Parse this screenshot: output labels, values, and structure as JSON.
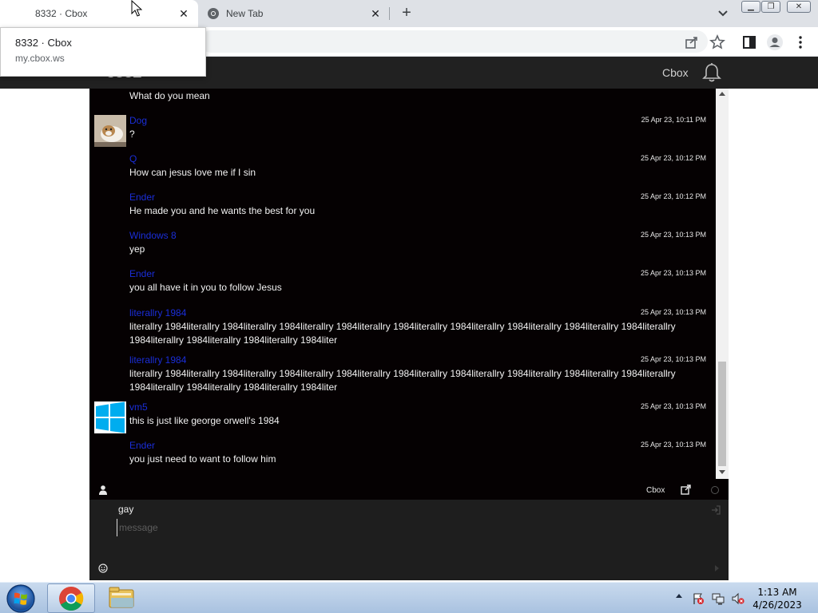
{
  "browser": {
    "tabs": [
      {
        "title": "8332 · Cbox",
        "active": true
      },
      {
        "title": "New Tab",
        "active": false
      }
    ],
    "tooltip": {
      "title": "8332 · Cbox",
      "url": "my.cbox.ws"
    }
  },
  "site": {
    "header_title": "8332",
    "header_link": "Cbox"
  },
  "chat": {
    "messages": [
      {
        "name": "",
        "time": "",
        "text": "What do you mean",
        "avatar": "none"
      },
      {
        "name": "Dog",
        "time": "25 Apr 23, 10:11 PM",
        "text": "?",
        "avatar": "dog-photo"
      },
      {
        "name": "Q",
        "time": "25 Apr 23, 10:12 PM",
        "text": "How can jesus love me if I sin",
        "avatar": "none"
      },
      {
        "name": "Ender",
        "time": "25 Apr 23, 10:12 PM",
        "text": "He made you and he wants the best for you",
        "avatar": "none"
      },
      {
        "name": "Windows 8",
        "time": "25 Apr 23, 10:13 PM",
        "text": "yep",
        "avatar": "none"
      },
      {
        "name": "Ender",
        "time": "25 Apr 23, 10:13 PM",
        "text": "you all have it in you to follow Jesus",
        "avatar": "none"
      },
      {
        "name": "literallry 1984",
        "time": "25 Apr 23, 10:13 PM",
        "text": "literallry 1984literallry 1984literallry 1984literallry 1984literallry 1984literallry 1984literallry 1984literallry 1984literallry 1984literallry 1984literallry 1984literallry 1984literallry 1984liter",
        "avatar": "none"
      },
      {
        "name": "literallry 1984",
        "time": "25 Apr 23, 10:13 PM",
        "text": "literallry 1984literallry 1984literallry 1984literallry 1984literallry 1984literallry 1984literallry 1984literallry 1984literallry 1984literallry 1984literallry 1984literallry 1984literallry 1984liter",
        "avatar": "none"
      },
      {
        "name": "vm5",
        "time": "25 Apr 23, 10:13 PM",
        "text": "this is just like george orwell's 1984",
        "avatar": "windows-logo"
      },
      {
        "name": "Ender",
        "time": "25 Apr 23, 10:13 PM",
        "text": "you just need to want to follow him",
        "avatar": "none"
      }
    ],
    "bar_label": "Cbox",
    "compose": {
      "username": "gay",
      "placeholder": "message"
    }
  },
  "taskbar": {
    "time": "1:13 AM",
    "date": "4/26/2023"
  },
  "colors": {
    "chat_bg": "#050102",
    "username": "#1a2ed8",
    "header_bg": "#212121",
    "compose_bg": "#1e1e1e"
  },
  "icons": [
    "bell-icon",
    "share-icon",
    "star-icon",
    "sidepanel-icon",
    "profile-icon",
    "menu-icon",
    "user-icon",
    "popout-icon",
    "login-icon",
    "emoji-icon",
    "windows-start-icon",
    "chrome-icon",
    "explorer-icon"
  ]
}
